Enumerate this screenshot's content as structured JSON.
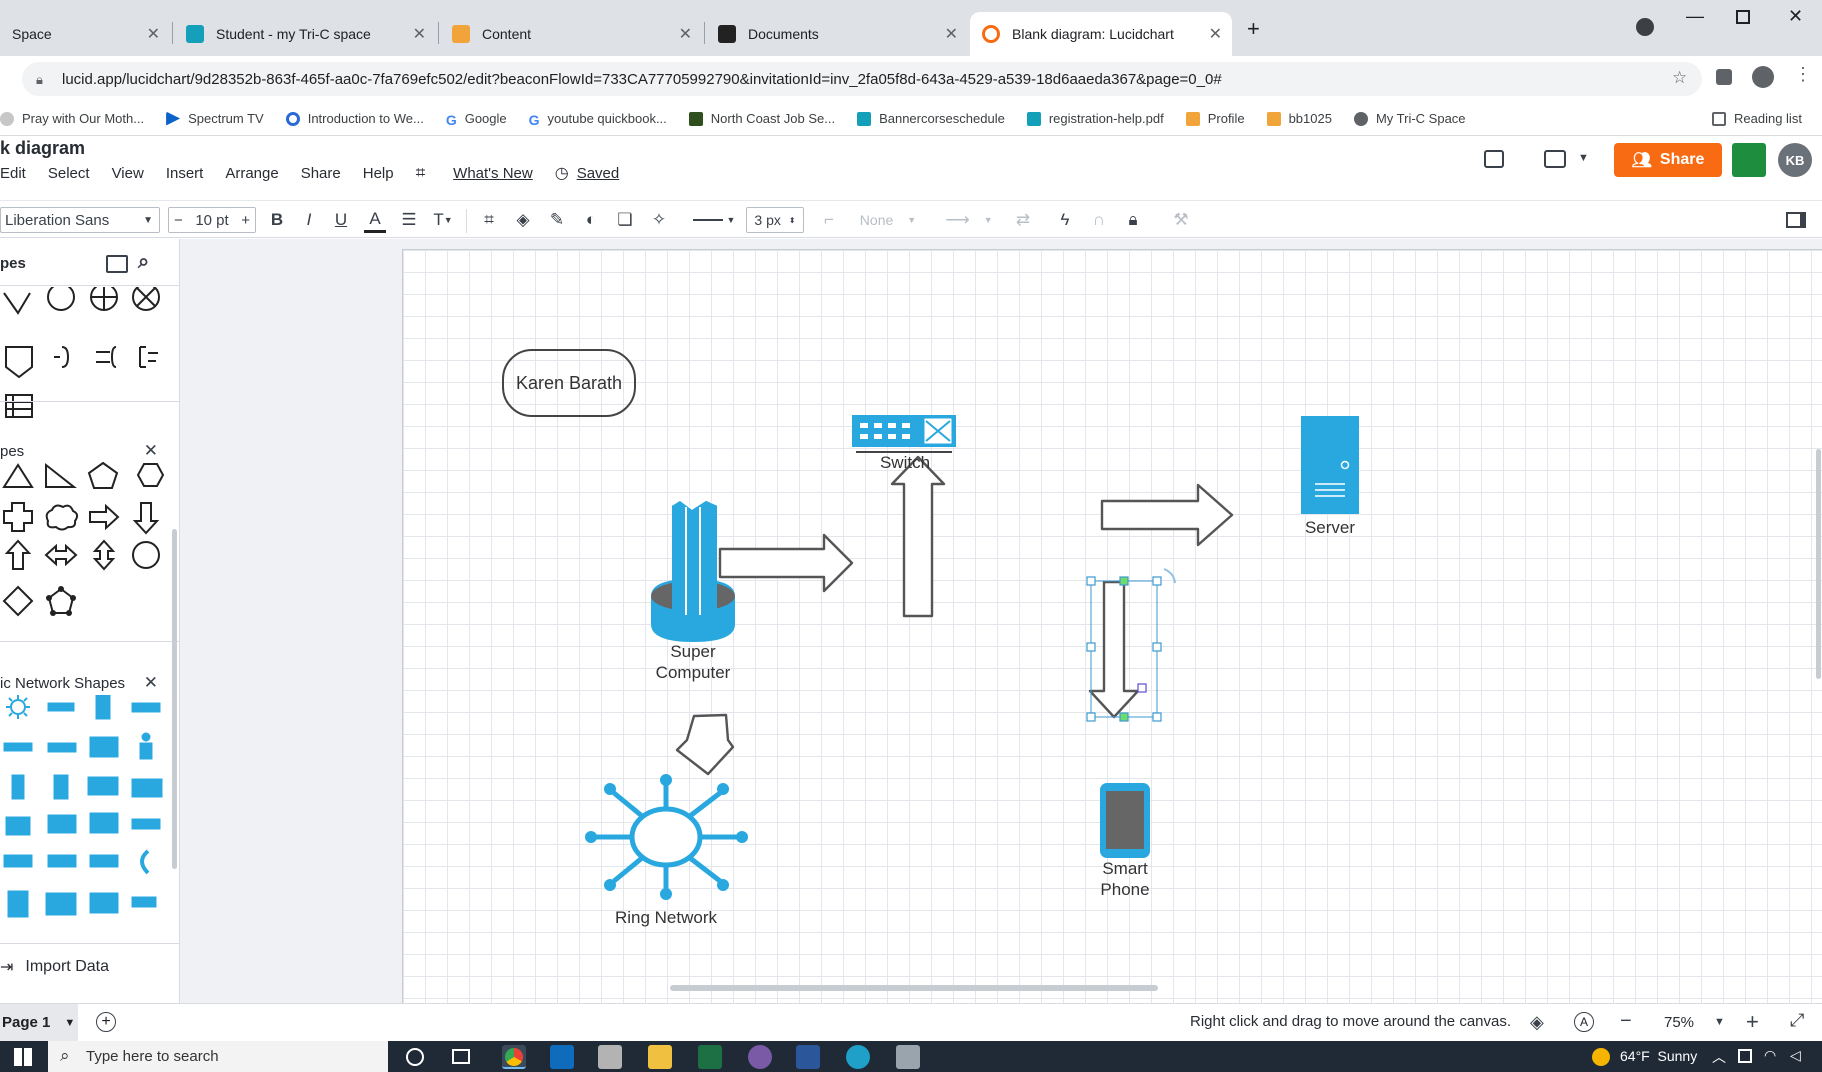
{
  "browser": {
    "tabs": [
      {
        "label": "Space",
        "active": false
      },
      {
        "label": "Student - my Tri-C space",
        "active": false
      },
      {
        "label": "Content",
        "active": false
      },
      {
        "label": "Documents",
        "active": false
      },
      {
        "label": "Blank diagram: Lucidchart",
        "active": true
      }
    ],
    "url": "lucid.app/lucidchart/9d28352b-863f-465f-aa0c-7fa769efc502/edit?beaconFlowId=733CA77705992790&invitationId=inv_2fa05f8d-643a-4529-a539-18d6aaeda367&page=0_0#",
    "bookmarks": [
      "Pray with Our Moth...",
      "Spectrum TV",
      "Introduction to We...",
      "Google",
      "youtube quickbook...",
      "North Coast Job Se...",
      "Bannercorseschedule",
      "registration-help.pdf",
      "Profile",
      "bb1025",
      "My Tri-C Space"
    ],
    "reading_list": "Reading list"
  },
  "app": {
    "title": "k diagram",
    "menu": [
      "Edit",
      "Select",
      "View",
      "Insert",
      "Arrange",
      "Share",
      "Help"
    ],
    "whats_new": "What's New",
    "saved": "Saved",
    "share_label": "Share",
    "avatar": "KB"
  },
  "toolbar": {
    "font": "Liberation Sans",
    "font_size": "10 pt",
    "minus": "−",
    "plus": "+",
    "bold": "B",
    "italic": "I",
    "underline": "U",
    "font_color": "A",
    "text_options": "T",
    "line_width": "3 px",
    "arrow_start": "None"
  },
  "left_panel": {
    "section1_title": "pes",
    "section2_title": "pes",
    "section3_title": "ic Network Shapes",
    "import_data": "Import Data"
  },
  "diagram": {
    "name_box": "Karen Barath",
    "switch": "Switch",
    "server": "Server",
    "supercomputer": [
      "Super",
      "Computer"
    ],
    "ring_network": "Ring Network",
    "smartphone": [
      "Smart",
      "Phone"
    ]
  },
  "bottom": {
    "page": "Page 1",
    "hint": "Right click and drag to move around the canvas.",
    "zoom": "75%"
  },
  "taskbar": {
    "search_placeholder": "Type here to search",
    "weather": "64°F  Sunny"
  },
  "colors": {
    "accent": "#f96b13",
    "network_blue": "#29a8e0",
    "selection": "#3d9ad1"
  }
}
